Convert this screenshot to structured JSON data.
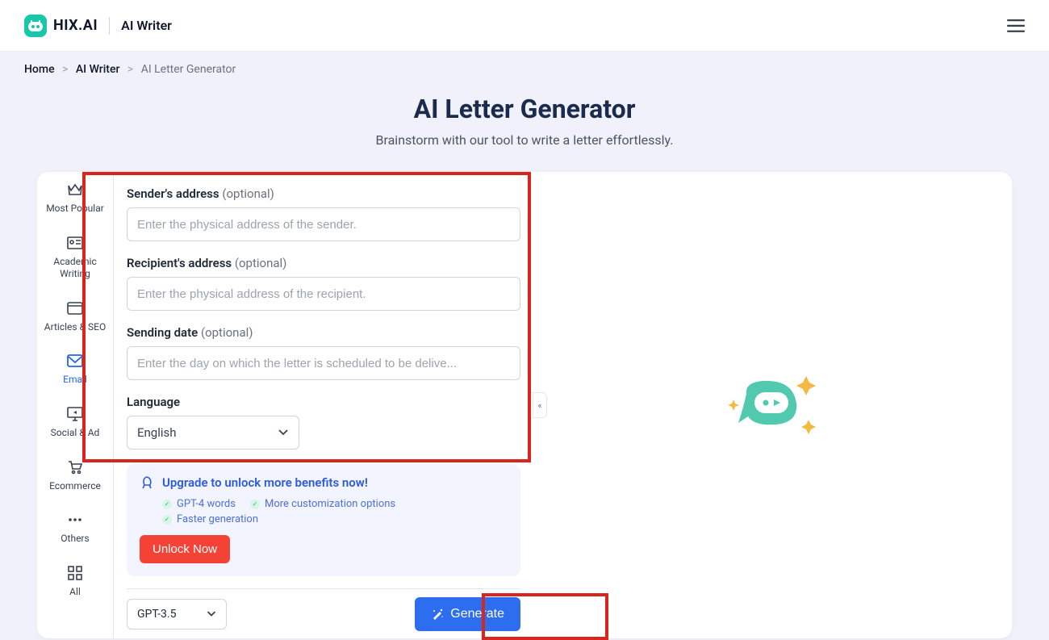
{
  "header": {
    "brand": "HIX.AI",
    "product": "AI Writer"
  },
  "breadcrumb": {
    "home": "Home",
    "section": "AI Writer",
    "current": "AI Letter Generator"
  },
  "page": {
    "title": "AI Letter Generator",
    "subtitle": "Brainstorm with our tool to write a letter effortlessly."
  },
  "sidebar": {
    "items": [
      {
        "label": "Most Popular"
      },
      {
        "label": "Academic Writing"
      },
      {
        "label": "Articles & SEO"
      },
      {
        "label": "Email"
      },
      {
        "label": "Social & Ad"
      },
      {
        "label": "Ecommerce"
      },
      {
        "label": "Others"
      },
      {
        "label": "All"
      }
    ]
  },
  "form": {
    "sender_label": "Sender's address",
    "sender_opt": "(optional)",
    "sender_placeholder": "Enter the physical address of the sender.",
    "recipient_label": "Recipient's address",
    "recipient_opt": "(optional)",
    "recipient_placeholder": "Enter the physical address of the recipient.",
    "date_label": "Sending date",
    "date_opt": "(optional)",
    "date_placeholder": "Enter the day on which the letter is scheduled to be delive...",
    "language_label": "Language",
    "language_value": "English"
  },
  "upgrade": {
    "title": "Upgrade to unlock more benefits now!",
    "benefits": [
      "GPT-4 words",
      "More customization options",
      "Faster generation"
    ],
    "unlock_label": "Unlock Now"
  },
  "footer": {
    "model": "GPT-3.5",
    "generate_label": "Generate"
  }
}
